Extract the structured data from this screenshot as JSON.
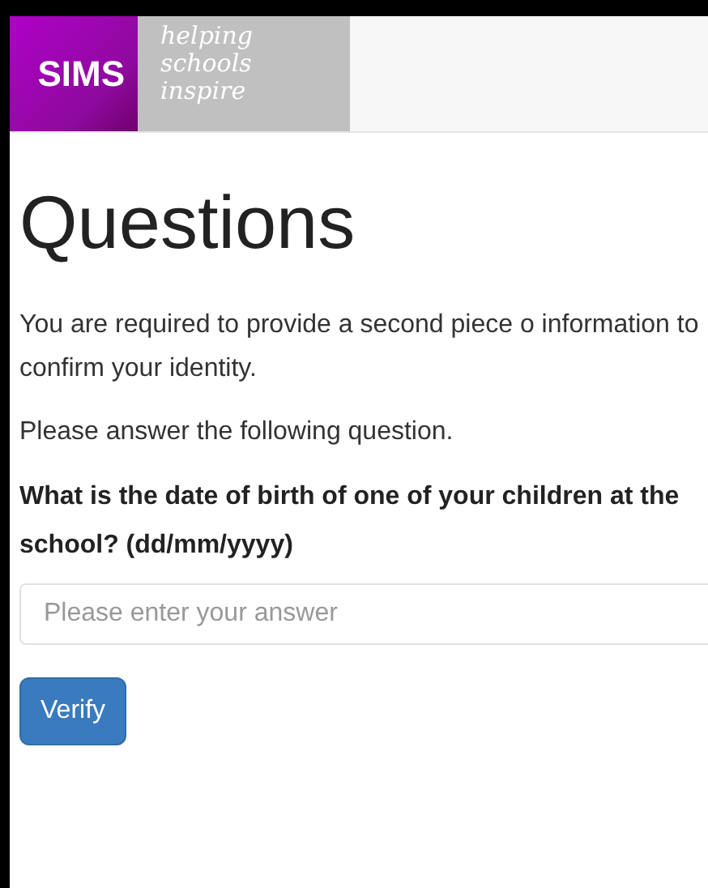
{
  "header": {
    "logo": "SIMS",
    "tagline": [
      "helping",
      "schools",
      "inspire"
    ]
  },
  "heading": "Questions",
  "intro": "You are required to provide a second piece o information to confirm your identity.",
  "instruction": "Please answer the following question.",
  "question": "What is the date of birth of one of your children at the school? (dd/mm/yyyy)",
  "answer": {
    "placeholder": "Please enter your answer"
  },
  "buttons": [
    "Verify"
  ]
}
